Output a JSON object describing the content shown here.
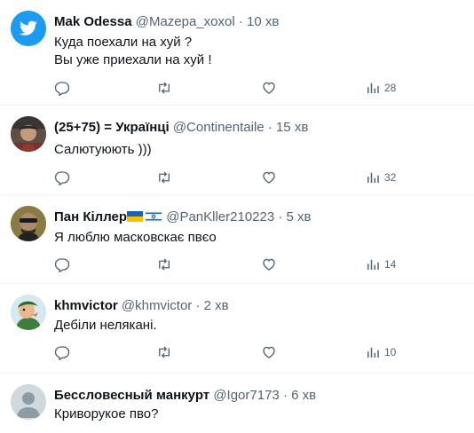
{
  "tweets": [
    {
      "name": "Mak Odessa",
      "handle": "@Mazepa_xoxol",
      "separator": "·",
      "time": "10 хв",
      "text": "Куда поехали на хуй ?\nВы уже приехали на хуй !",
      "views": "28",
      "avatar": "twitter-bird-avatar"
    },
    {
      "name": "(25+75) = Українці",
      "handle": "@Continentaile",
      "separator": "·",
      "time": "15 хв",
      "text": "Салютуюють )))",
      "views": "32",
      "avatar": "photo-avatar"
    },
    {
      "name": "Пан Кіллер",
      "handle": "@PanKller210223",
      "separator": "·",
      "time": "5 хв",
      "text": "Я люблю масковскає пвєо",
      "views": "14",
      "avatar": "photo-avatar",
      "flags": [
        "ukraine-flag",
        "israel-flag"
      ]
    },
    {
      "name": "khmvictor",
      "handle": "@khmvictor",
      "separator": "·",
      "time": "2 хв",
      "text": "Дебіли нелякані.",
      "views": "10",
      "avatar": "cartoon-avatar"
    },
    {
      "name": "Бессловесный манкурт",
      "handle": "@Igor7173",
      "separator": "·",
      "time": "6 хв",
      "text": "Криворукое пво?",
      "views": "",
      "avatar": "default-avatar"
    }
  ],
  "colors": {
    "twitter_blue": "#1d9bf0",
    "text": "#0f1419",
    "muted": "#536471",
    "divider": "#eff3f4"
  },
  "icons": [
    "reply-icon",
    "retweet-icon",
    "like-icon",
    "views-icon"
  ]
}
